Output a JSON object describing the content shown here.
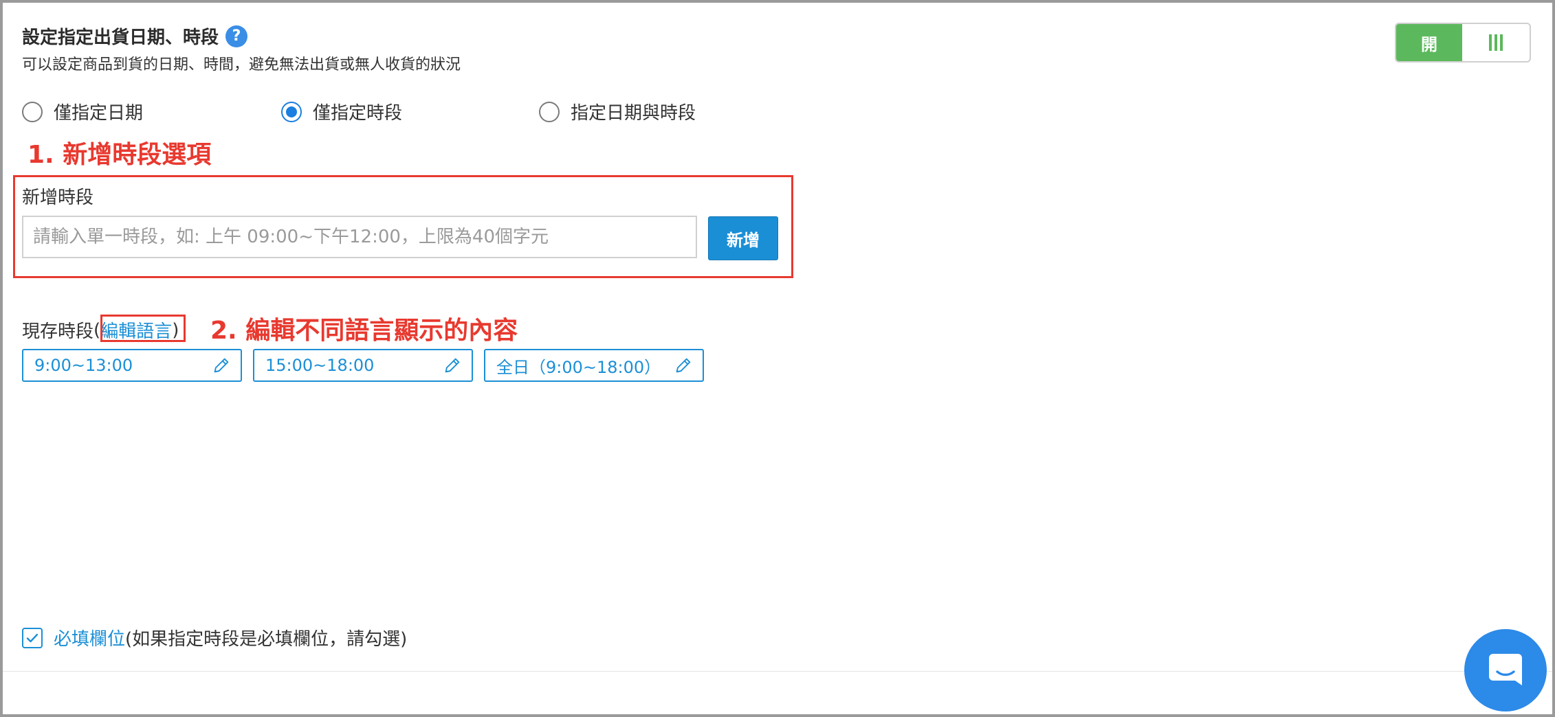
{
  "header": {
    "title": "設定指定出貨日期、時段",
    "help_icon": "?",
    "subtitle": "可以設定商品到貨的日期、時間，避免無法出貨或無人收貨的狀況"
  },
  "toggle": {
    "on_label": "開",
    "off_icon": "bars-icon",
    "state": "on",
    "on_color": "#5cb85c"
  },
  "radio_options": [
    {
      "label": "僅指定日期",
      "checked": false
    },
    {
      "label": "僅指定時段",
      "checked": true
    },
    {
      "label": "指定日期與時段",
      "checked": false
    }
  ],
  "annotations": {
    "step1": "1. 新增時段選項",
    "step2": "2. 編輯不同語言顯示的內容",
    "color": "#e8392f"
  },
  "add_slot": {
    "label": "新增時段",
    "placeholder": "請輸入單一時段，如: 上午 09:00~下午12:00，上限為40個字元",
    "value": "",
    "button_label": "新增",
    "button_color": "#1b8fd6"
  },
  "existing": {
    "label": "現存時段",
    "paren_open": "(",
    "edit_language_link": "編輯語言",
    "paren_close": ")",
    "slots": [
      {
        "text": "9:00~13:00",
        "icon": "pencil-icon"
      },
      {
        "text": "15:00~18:00",
        "icon": "pencil-icon"
      },
      {
        "text": "全日（9:00~18:00）",
        "icon": "pencil-icon"
      }
    ]
  },
  "required": {
    "checked": true,
    "label": "必填欄位",
    "note": "(如果指定時段是必填欄位，請勾選)"
  },
  "chat_widget": {
    "icon": "chat-icon",
    "color": "#2c8ae8"
  }
}
